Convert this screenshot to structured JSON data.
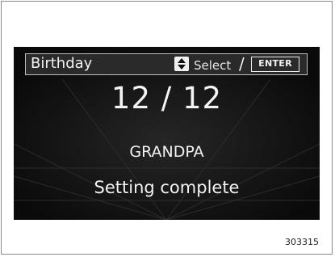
{
  "screen": {
    "header": {
      "title": "Birthday",
      "select_label": "Select",
      "slash": "/",
      "enter_key": "ENTER",
      "updown_icon": "up-down-arrows-icon"
    },
    "date": "12 / 12",
    "name": "GRANDPA",
    "status": "Setting complete"
  },
  "figure_id": "303315",
  "colors": {
    "screen_background": "#0d0d0d",
    "text": "#f2f2f2",
    "frame": "#8a8a8a"
  }
}
